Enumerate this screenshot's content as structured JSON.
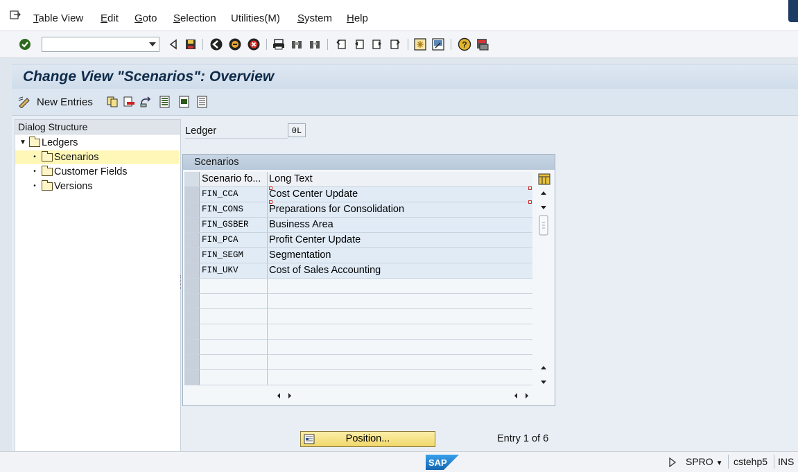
{
  "menu": {
    "items": [
      {
        "acc": "T",
        "rest": "able View"
      },
      {
        "acc": "E",
        "rest": "dit"
      },
      {
        "acc": "G",
        "rest": "oto"
      },
      {
        "acc": "S",
        "rest": "election"
      },
      {
        "acc": "",
        "rest": "Utilities(M)"
      },
      {
        "acc": "S",
        "rest": "ystem"
      },
      {
        "acc": "H",
        "rest": "elp"
      }
    ]
  },
  "toolbar": {
    "command_value": "",
    "icons": [
      "enter-icon",
      "back-icon",
      "save-icon",
      "back-green-icon",
      "exit-icon",
      "cancel-icon",
      "print-icon",
      "find-icon",
      "find-next-icon",
      "first-page-icon",
      "previous-page-icon",
      "next-page-icon",
      "last-page-icon",
      "create-session-icon",
      "shortcut-icon",
      "help-icon",
      "layout-icon"
    ]
  },
  "title": "Change View \"Scenarios\": Overview",
  "app_toolbar": {
    "new_entries_label": "New Entries"
  },
  "dialog_structure": {
    "header": "Dialog Structure",
    "root": "Ledgers",
    "children": [
      "Scenarios",
      "Customer Fields",
      "Versions"
    ],
    "selected": "Scenarios"
  },
  "ledger": {
    "label": "Ledger",
    "value": "0L"
  },
  "table": {
    "title": "Scenarios",
    "columns": [
      "Scenario fo...",
      "Long Text"
    ],
    "rows": [
      [
        "FIN_CCA",
        "Cost Center Update"
      ],
      [
        "FIN_CONS",
        "Preparations for Consolidation"
      ],
      [
        "FIN_GSBER",
        "Business Area"
      ],
      [
        "FIN_PCA",
        "Profit Center Update"
      ],
      [
        "FIN_SEGM",
        "Segmentation"
      ],
      [
        "FIN_UKV",
        "Cost of Sales Accounting"
      ]
    ],
    "empty_rows": 7
  },
  "position_button": "Position...",
  "entry_count": "Entry 1 of 6",
  "status": {
    "transaction": "SPRO",
    "system": "cstehp5",
    "mode": "INS",
    "logo": "SAP"
  },
  "colors": {
    "title_text": "#0f2b4a",
    "selected_tree": "#fff7b8",
    "position_button": "#f4df7c",
    "sap_blue": "#1a76c8"
  }
}
